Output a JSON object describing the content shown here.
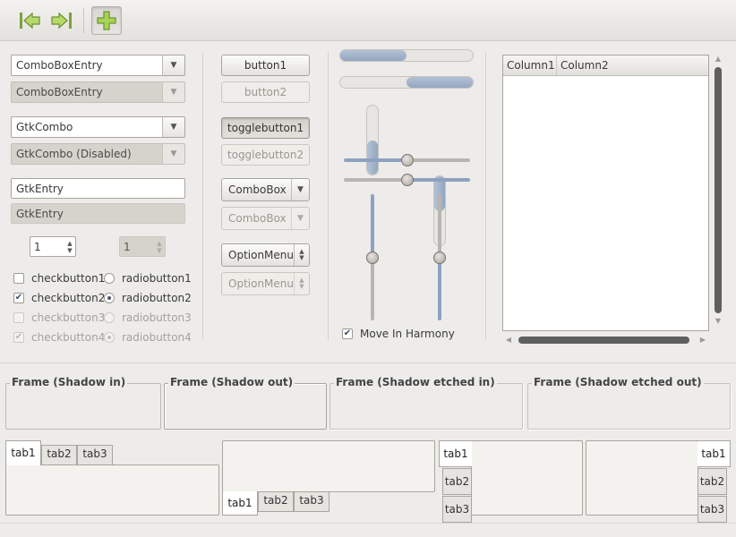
{
  "toolbar": {
    "icons": [
      "back-arrow-icon",
      "forward-arrow-icon",
      "add-icon"
    ]
  },
  "combos": {
    "combo_entry": "ComboBoxEntry",
    "combo_entry_disabled": "ComboBoxEntry",
    "gtk_combo": "GtkCombo",
    "gtk_combo_disabled": "GtkCombo (Disabled)"
  },
  "entries": {
    "entry": "GtkEntry",
    "entry_disabled": "GtkEntry"
  },
  "spins": {
    "spin": "1",
    "spin_disabled": "1"
  },
  "checks": [
    {
      "label": "checkbutton1",
      "checked": false,
      "enabled": true
    },
    {
      "label": "checkbutton2",
      "checked": true,
      "enabled": true
    },
    {
      "label": "checkbutton3",
      "checked": false,
      "enabled": false
    },
    {
      "label": "checkbutton4",
      "checked": true,
      "enabled": false
    }
  ],
  "radios": [
    {
      "label": "radiobutton1",
      "selected": false,
      "enabled": true
    },
    {
      "label": "radiobutton2",
      "selected": true,
      "enabled": true
    },
    {
      "label": "radiobutton3",
      "selected": false,
      "enabled": false
    },
    {
      "label": "radiobutton4",
      "selected": true,
      "enabled": false
    }
  ],
  "buttons": {
    "button1": "button1",
    "button2": "button2",
    "toggle1": "togglebutton1",
    "toggle2": "togglebutton2",
    "combobox": "ComboBox",
    "combobox_disabled": "ComboBox",
    "optionmenu": "OptionMenu",
    "optionmenu_disabled": "OptionMenu"
  },
  "progress": {
    "h1_fraction": 0.5,
    "h2_fraction": 0.5,
    "v1_fraction": 0.5,
    "v2_fraction": 0.5
  },
  "scales": {
    "h1_value": 0.5,
    "h2_value": 0.5,
    "v1_value": 0.5,
    "v2_value": 0.5
  },
  "harmony_label": "Move In Harmony",
  "tree": {
    "columns": [
      "Column1",
      "Column2"
    ]
  },
  "frames": [
    "Frame (Shadow in)",
    "Frame (Shadow out)",
    "Frame (Shadow etched in)",
    "Frame (Shadow etched out)"
  ],
  "notebooks": {
    "tabs": [
      "tab1",
      "tab2",
      "tab3"
    ]
  },
  "colors": {
    "accent": "#93a7c2",
    "track": "#8ea2bf",
    "background": "#edecea"
  }
}
